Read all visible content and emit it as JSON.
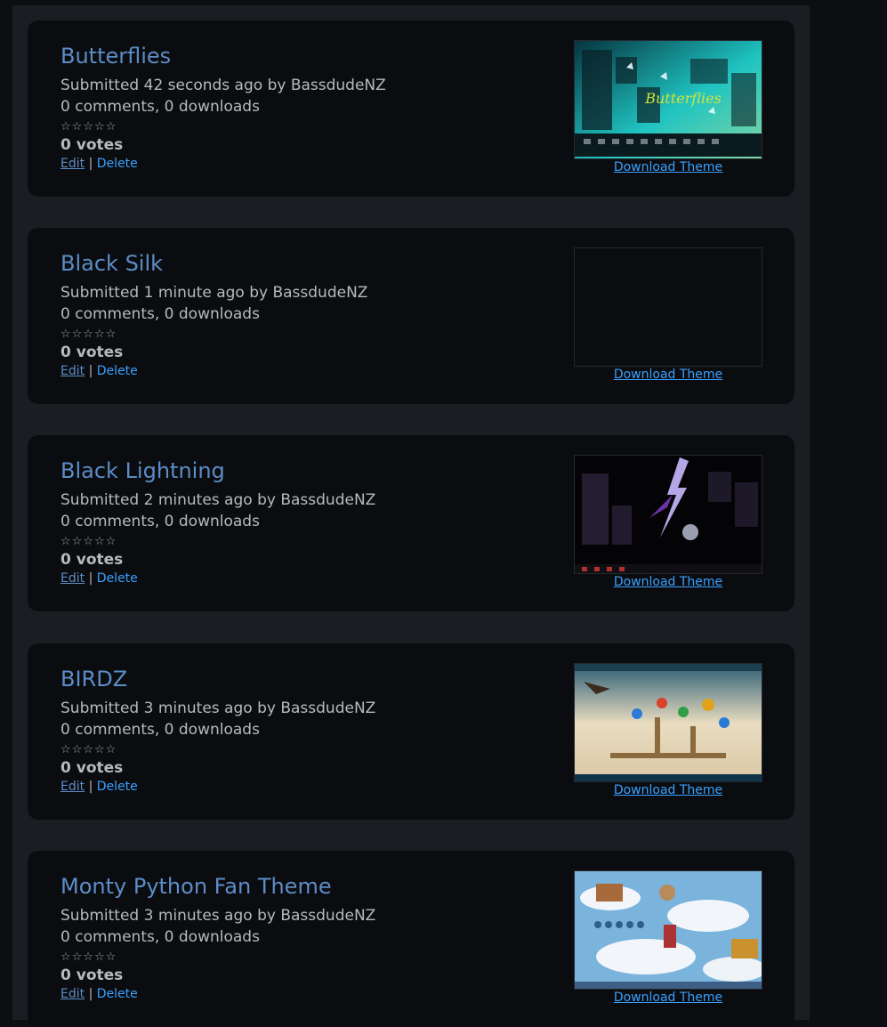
{
  "themes": [
    {
      "title": "Butterflies",
      "submitted": "Submitted 42 seconds ago by BassdudeNZ",
      "counts": "0 comments, 0 downloads",
      "rating_stars": "☆☆☆☆☆",
      "votes": "0 votes",
      "edit_label": "Edit",
      "separator": "|",
      "delete_label": "Delete",
      "download_label": "Download Theme",
      "thumbnail_word": "Butterflies",
      "thumbnail_colors": [
        "#06343f",
        "#1fc4c1",
        "#86d6a0"
      ]
    },
    {
      "title": "Black Silk",
      "submitted": "Submitted 1 minute ago by BassdudeNZ",
      "counts": "0 comments, 0 downloads",
      "rating_stars": "☆☆☆☆☆",
      "votes": "0 votes",
      "edit_label": "Edit",
      "separator": "|",
      "delete_label": "Delete",
      "download_label": "Download Theme",
      "thumbnail_colors": [
        "#0b0c0f",
        "#0b0c0f",
        "#0b0c0f"
      ]
    },
    {
      "title": "Black Lightning",
      "submitted": "Submitted 2 minutes ago by BassdudeNZ",
      "counts": "0 comments, 0 downloads",
      "rating_stars": "☆☆☆☆☆",
      "votes": "0 votes",
      "edit_label": "Edit",
      "separator": "|",
      "delete_label": "Delete",
      "download_label": "Download Theme",
      "thumbnail_colors": [
        "#040406",
        "#8a3fd0",
        "#c9b8ff"
      ]
    },
    {
      "title": "BIRDZ",
      "submitted": "Submitted 3 minutes ago by BassdudeNZ",
      "counts": "0 comments, 0 downloads",
      "rating_stars": "☆☆☆☆☆",
      "votes": "0 votes",
      "edit_label": "Edit",
      "separator": "|",
      "delete_label": "Delete",
      "download_label": "Download Theme",
      "thumbnail_colors": [
        "#2b5d74",
        "#e9dcc0",
        "#d9412b"
      ]
    },
    {
      "title": "Monty Python Fan Theme",
      "submitted": "Submitted 3 minutes ago by BassdudeNZ",
      "counts": "0 comments, 0 downloads",
      "rating_stars": "☆☆☆☆☆",
      "votes": "0 votes",
      "edit_label": "Edit",
      "separator": "|",
      "delete_label": "Delete",
      "download_label": "Download Theme",
      "thumbnail_colors": [
        "#7ab3dc",
        "#f2f6fa",
        "#a86a3a"
      ]
    }
  ]
}
